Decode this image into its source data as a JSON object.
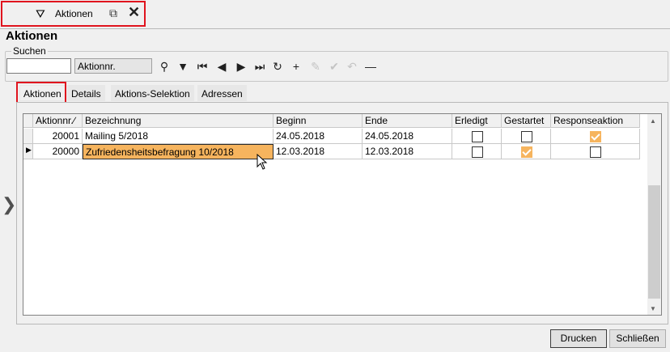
{
  "window_tab": {
    "title": "Aktionen",
    "app_icon": "funnel-icon",
    "popout_icon": "external-link-icon",
    "close_icon": "close-icon"
  },
  "page": {
    "title": "Aktionen"
  },
  "search": {
    "legend": "Suchen",
    "input_value": "",
    "field_select": "Aktionnr.",
    "toolbar": [
      {
        "name": "search-icon",
        "glyph": "⚲",
        "enabled": true
      },
      {
        "name": "filter-icon",
        "glyph": "▼",
        "enabled": true
      },
      {
        "name": "first-record-icon",
        "glyph": "⏮",
        "enabled": true
      },
      {
        "name": "previous-record-icon",
        "glyph": "◀",
        "enabled": true
      },
      {
        "name": "next-record-icon",
        "glyph": "▶",
        "enabled": true
      },
      {
        "name": "last-record-icon",
        "glyph": "⏭",
        "enabled": true
      },
      {
        "name": "refresh-icon",
        "glyph": "↻",
        "enabled": true
      },
      {
        "name": "add-icon",
        "glyph": "+",
        "enabled": true
      },
      {
        "name": "edit-icon",
        "glyph": "✎",
        "enabled": false
      },
      {
        "name": "save-check-icon",
        "glyph": "✔",
        "enabled": false
      },
      {
        "name": "undo-icon",
        "glyph": "↶",
        "enabled": false
      },
      {
        "name": "delete-icon",
        "glyph": "—",
        "enabled": true
      }
    ]
  },
  "tabs": [
    {
      "label": "Aktionen",
      "active": true
    },
    {
      "label": "Details",
      "active": false
    },
    {
      "label": "Aktions-Selektion",
      "active": false
    },
    {
      "label": "Adressen",
      "active": false
    }
  ],
  "grid": {
    "columns": [
      "Aktionnr.",
      "Bezeichnung",
      "Beginn",
      "Ende",
      "Erledigt",
      "Gestartet",
      "Responseaktion"
    ],
    "sort_indicator": "∕",
    "rows": [
      {
        "aktionnr": "20001",
        "bezeichnung": "Mailing 5/2018",
        "beginn": "24.05.2018",
        "ende": "24.05.2018",
        "erledigt": false,
        "gestartet": false,
        "responseaktion": true,
        "current": false
      },
      {
        "aktionnr": "20000",
        "bezeichnung": "Zufriedensheitsbefragung 10/2018",
        "beginn": "12.03.2018",
        "ende": "12.03.2018",
        "erledigt": false,
        "gestartet": true,
        "responseaktion": false,
        "current": true
      }
    ]
  },
  "buttons": {
    "print": "Drucken",
    "close": "Schließen"
  },
  "colors": {
    "highlight": "#f6b45e",
    "outline": "#e0141e"
  }
}
